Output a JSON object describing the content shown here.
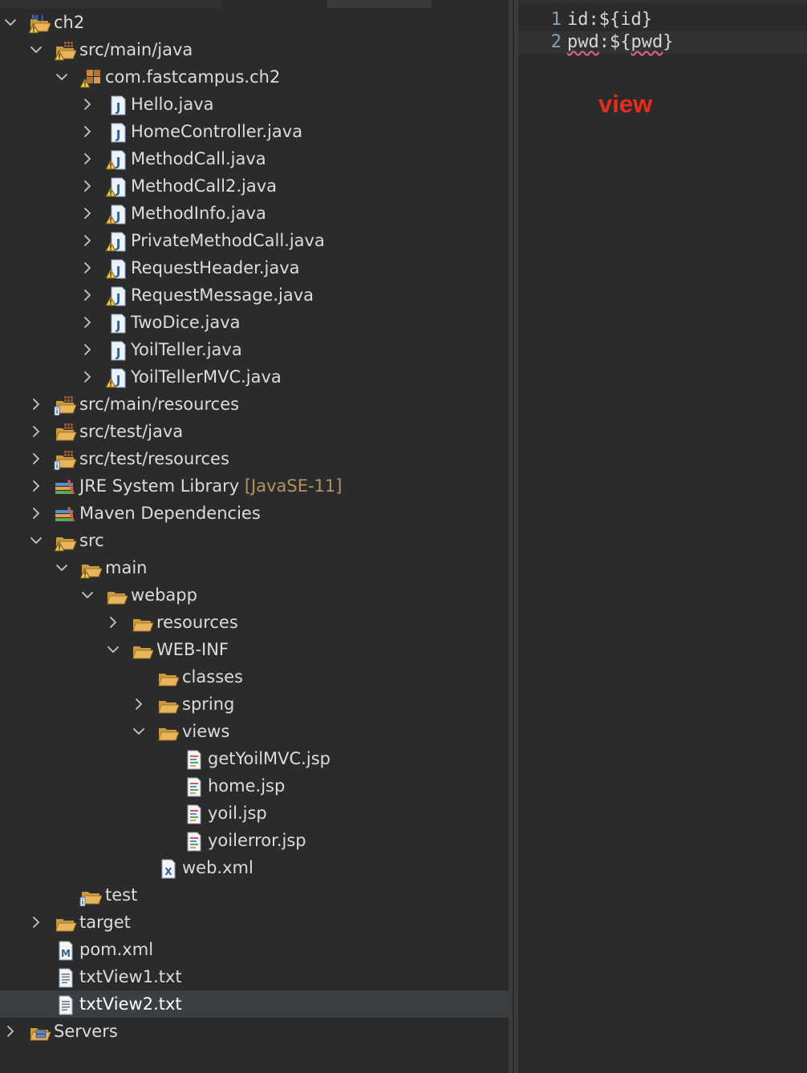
{
  "explorer": {
    "rows": [
      {
        "label": "ch2",
        "decoration": "",
        "depth": 0,
        "chevron": "down",
        "icon": "maven-project-warning-icon"
      },
      {
        "label": "src/main/java",
        "decoration": "",
        "depth": 1,
        "chevron": "down",
        "icon": "source-folder-warning-icon"
      },
      {
        "label": "com.fastcampus.ch2",
        "decoration": "",
        "depth": 2,
        "chevron": "down",
        "icon": "package-warning-icon"
      },
      {
        "label": "Hello.java",
        "decoration": "",
        "depth": 3,
        "chevron": "right",
        "icon": "java-file-icon"
      },
      {
        "label": "HomeController.java",
        "decoration": "",
        "depth": 3,
        "chevron": "right",
        "icon": "java-file-icon"
      },
      {
        "label": "MethodCall.java",
        "decoration": "",
        "depth": 3,
        "chevron": "right",
        "icon": "java-file-warning-icon"
      },
      {
        "label": "MethodCall2.java",
        "decoration": "",
        "depth": 3,
        "chevron": "right",
        "icon": "java-file-warning-icon"
      },
      {
        "label": "MethodInfo.java",
        "decoration": "",
        "depth": 3,
        "chevron": "right",
        "icon": "java-file-warning-icon"
      },
      {
        "label": "PrivateMethodCall.java",
        "decoration": "",
        "depth": 3,
        "chevron": "right",
        "icon": "java-file-warning-icon"
      },
      {
        "label": "RequestHeader.java",
        "decoration": "",
        "depth": 3,
        "chevron": "right",
        "icon": "java-file-warning-icon"
      },
      {
        "label": "RequestMessage.java",
        "decoration": "",
        "depth": 3,
        "chevron": "right",
        "icon": "java-file-warning-icon"
      },
      {
        "label": "TwoDice.java",
        "decoration": "",
        "depth": 3,
        "chevron": "right",
        "icon": "java-file-icon"
      },
      {
        "label": "YoilTeller.java",
        "decoration": "",
        "depth": 3,
        "chevron": "right",
        "icon": "java-file-icon"
      },
      {
        "label": "YoilTellerMVC.java",
        "decoration": "",
        "depth": 3,
        "chevron": "right",
        "icon": "java-file-warning-icon"
      },
      {
        "label": "src/main/resources",
        "decoration": "",
        "depth": 1,
        "chevron": "right",
        "icon": "source-folder-info-icon"
      },
      {
        "label": "src/test/java",
        "decoration": "",
        "depth": 1,
        "chevron": "right",
        "icon": "source-folder-icon"
      },
      {
        "label": "src/test/resources",
        "decoration": "",
        "depth": 1,
        "chevron": "right",
        "icon": "source-folder-info-icon"
      },
      {
        "label": "JRE System Library",
        "decoration": "[JavaSE-11]",
        "depth": 1,
        "chevron": "right",
        "icon": "library-icon"
      },
      {
        "label": "Maven Dependencies",
        "decoration": "",
        "depth": 1,
        "chevron": "right",
        "icon": "library-icon"
      },
      {
        "label": "src",
        "decoration": "",
        "depth": 1,
        "chevron": "down",
        "icon": "folder-open-warning-icon"
      },
      {
        "label": "main",
        "decoration": "",
        "depth": 2,
        "chevron": "down",
        "icon": "folder-open-warning-icon"
      },
      {
        "label": "webapp",
        "decoration": "",
        "depth": 3,
        "chevron": "down",
        "icon": "folder-open-icon"
      },
      {
        "label": "resources",
        "decoration": "",
        "depth": 4,
        "chevron": "right",
        "icon": "folder-open-icon"
      },
      {
        "label": "WEB-INF",
        "decoration": "",
        "depth": 4,
        "chevron": "down",
        "icon": "folder-open-icon"
      },
      {
        "label": "classes",
        "decoration": "",
        "depth": 5,
        "chevron": "none",
        "icon": "folder-open-icon"
      },
      {
        "label": "spring",
        "decoration": "",
        "depth": 5,
        "chevron": "right",
        "icon": "folder-open-icon"
      },
      {
        "label": "views",
        "decoration": "",
        "depth": 5,
        "chevron": "down",
        "icon": "folder-open-icon"
      },
      {
        "label": "getYoilMVC.jsp",
        "decoration": "",
        "depth": 6,
        "chevron": "none",
        "icon": "jsp-file-icon"
      },
      {
        "label": "home.jsp",
        "decoration": "",
        "depth": 6,
        "chevron": "none",
        "icon": "jsp-file-icon"
      },
      {
        "label": "yoil.jsp",
        "decoration": "",
        "depth": 6,
        "chevron": "none",
        "icon": "jsp-file-icon"
      },
      {
        "label": "yoilerror.jsp",
        "decoration": "",
        "depth": 6,
        "chevron": "none",
        "icon": "jsp-file-icon"
      },
      {
        "label": "web.xml",
        "decoration": "",
        "depth": 5,
        "chevron": "none",
        "icon": "xml-file-icon"
      },
      {
        "label": "test",
        "decoration": "",
        "depth": 2,
        "chevron": "none",
        "icon": "folder-open-info-icon"
      },
      {
        "label": "target",
        "decoration": "",
        "depth": 1,
        "chevron": "right",
        "icon": "folder-open-icon"
      },
      {
        "label": "pom.xml",
        "decoration": "",
        "depth": 1,
        "chevron": "none",
        "icon": "maven-pom-icon"
      },
      {
        "label": "txtView1.txt",
        "decoration": "",
        "depth": 1,
        "chevron": "none",
        "icon": "text-file-icon"
      },
      {
        "label": "txtView2.txt",
        "decoration": "",
        "depth": 1,
        "chevron": "none",
        "icon": "text-file-icon",
        "selected": true
      },
      {
        "label": "Servers",
        "decoration": "",
        "depth": 0,
        "chevron": "right",
        "icon": "servers-folder-icon"
      }
    ]
  },
  "editor": {
    "lines": [
      {
        "number": "1",
        "segments": [
          {
            "text": "id:${id}",
            "squiggle": false
          }
        ]
      },
      {
        "number": "2",
        "segments": [
          {
            "text": "pwd",
            "squiggle": true
          },
          {
            "text": ":${",
            "squiggle": false
          },
          {
            "text": "pwd",
            "squiggle": true
          },
          {
            "text": "}",
            "squiggle": false
          }
        ]
      }
    ],
    "annotation": "view",
    "annotation_color": "#ee2a1c"
  },
  "colors": {
    "background": "#2b2b2b",
    "selection": "#3c3f41",
    "decoration": "#b4935d",
    "folder": "#e8b55a",
    "java_blue": "#2f5fa0"
  }
}
